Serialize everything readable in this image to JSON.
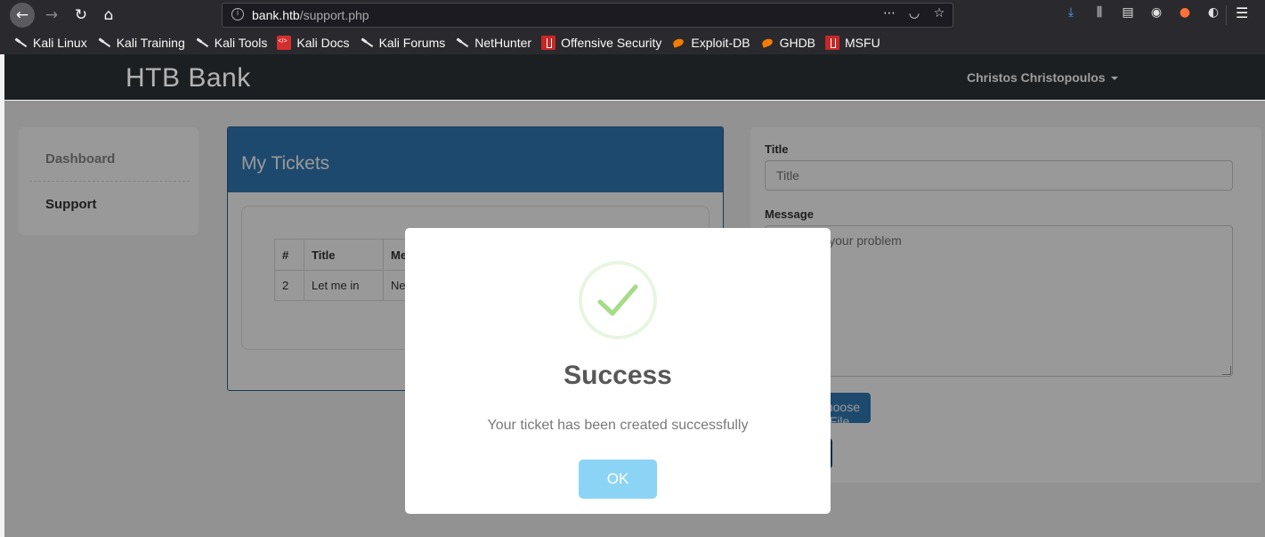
{
  "browser": {
    "url_host": "bank.htb",
    "url_path": "/support.php",
    "info_glyph": "i",
    "bookmarks": [
      {
        "label": "Kali Linux",
        "icon": "kali-dragon-icon"
      },
      {
        "label": "Kali Training",
        "icon": "kali-dragon-icon"
      },
      {
        "label": "Kali Tools",
        "icon": "kali-dragon-icon"
      },
      {
        "label": "Kali Docs",
        "icon": "kali-docs-icon"
      },
      {
        "label": "Kali Forums",
        "icon": "kali-dragon-icon"
      },
      {
        "label": "NetHunter",
        "icon": "kali-dragon-icon"
      },
      {
        "label": "Offensive Security",
        "icon": "offsec-icon"
      },
      {
        "label": "Exploit-DB",
        "icon": "exploit-db-icon"
      },
      {
        "label": "GHDB",
        "icon": "exploit-db-icon"
      },
      {
        "label": "MSFU",
        "icon": "offsec-icon"
      }
    ]
  },
  "site": {
    "brand": "HTB Bank",
    "user_name": "Christos Christopoulos"
  },
  "sidebar": {
    "items": [
      {
        "label": "Dashboard"
      },
      {
        "label": "Support"
      }
    ]
  },
  "tickets": {
    "heading": "My Tickets",
    "columns": [
      "#",
      "Title",
      "Me"
    ],
    "rows": [
      {
        "num": "2",
        "title": "Let me in",
        "message": "Nee"
      }
    ]
  },
  "form": {
    "title_label": "Title",
    "title_placeholder": "Title",
    "message_label": "Message",
    "message_placeholder": "Describe your problem",
    "file_button": "Choose File..."
  },
  "modal": {
    "title": "Success",
    "text": "Your ticket has been created successfully",
    "ok_label": "OK",
    "icon": "checkmark-icon"
  },
  "colors": {
    "navbar": "#1c1f22",
    "panel_primary": "#337ab7",
    "success_check": "#a5dc86",
    "ok_button": "#8cd4f5"
  }
}
